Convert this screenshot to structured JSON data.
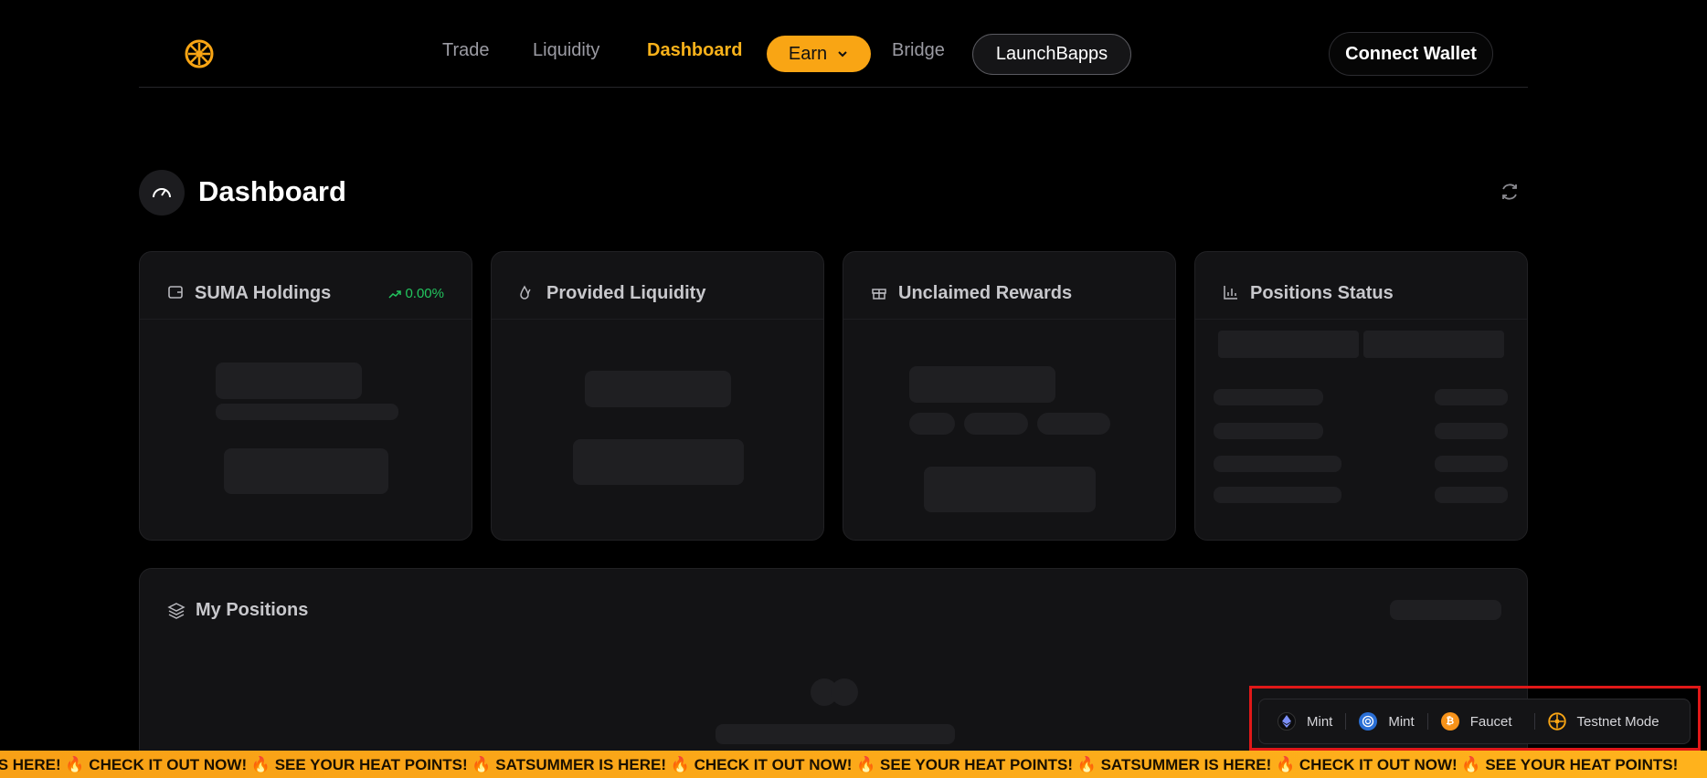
{
  "nav": {
    "trade": "Trade",
    "liquidity": "Liquidity",
    "dashboard": "Dashboard",
    "earn": "Earn",
    "bridge": "Bridge",
    "launch": "LaunchBapps",
    "connect_wallet": "Connect Wallet"
  },
  "page": {
    "title": "Dashboard"
  },
  "cards": {
    "holdings": {
      "title": "SUMA Holdings",
      "change": "0.00%"
    },
    "liquidity": {
      "title": "Provided Liquidity"
    },
    "rewards": {
      "title": "Unclaimed Rewards"
    },
    "status": {
      "title": "Positions Status"
    }
  },
  "positions": {
    "title": "My Positions"
  },
  "testnet_bar": {
    "mint_eth_label": "Mint",
    "mint_usd_label": "Mint",
    "faucet_label": "Faucet",
    "testnet_mode_label": "Testnet Mode"
  },
  "ticker": {
    "text": "R IS HERE! 🔥 CHECK IT OUT NOW! 🔥 SEE YOUR HEAT POINTS! 🔥 SATSUMMER IS HERE! 🔥 CHECK IT OUT NOW! 🔥 SEE YOUR HEAT POINTS! 🔥 SATSUMMER IS HERE! 🔥 CHECK IT OUT NOW! 🔥 SEE YOUR HEAT POINTS!"
  },
  "colors": {
    "accent": "#f9b21a",
    "positive": "#22c55e",
    "highlight": "#e01818"
  },
  "icons": [
    "sun-logo-icon",
    "chevron-down-icon",
    "speedometer-icon",
    "refresh-icon",
    "wallet-icon",
    "trend-up-icon",
    "droplets-icon",
    "gift-icon",
    "bar-chart-icon",
    "layers-icon",
    "ethereum-icon",
    "usd-coin-icon",
    "bitcoin-icon",
    "sun-logo-icon"
  ]
}
